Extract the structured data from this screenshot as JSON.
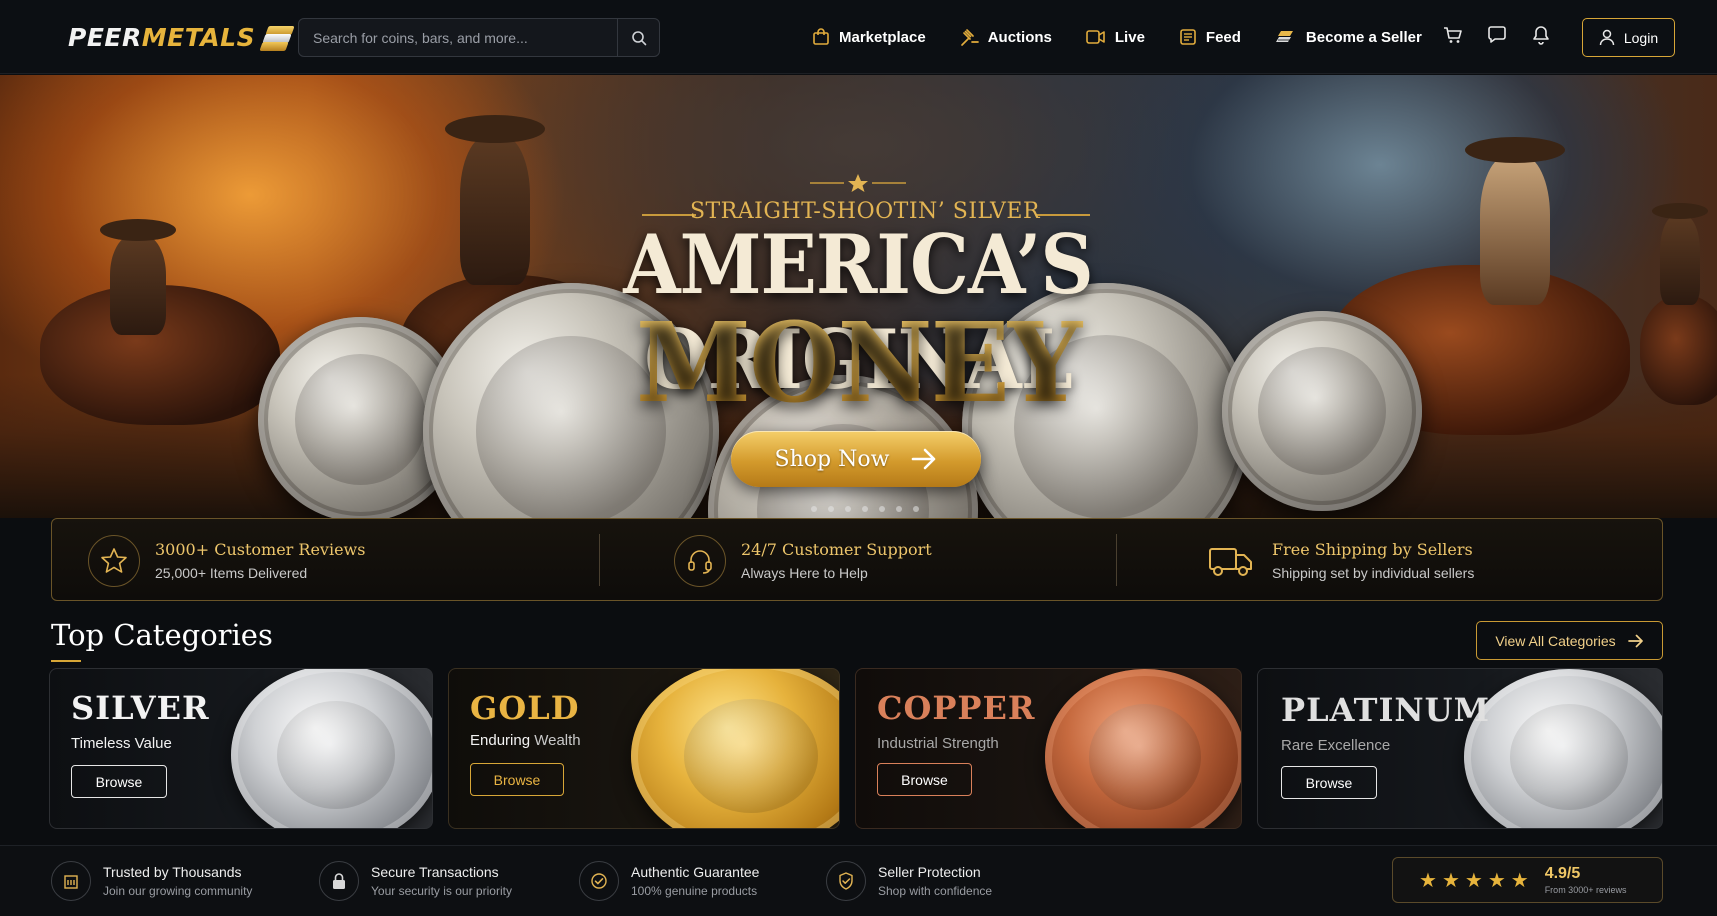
{
  "header": {
    "logo_part1": "PEER",
    "logo_part2": "METALS",
    "search_placeholder": "Search for coins, bars, and more...",
    "nav": [
      {
        "label": "Marketplace",
        "icon": "shopping-bag-icon"
      },
      {
        "label": "Auctions",
        "icon": "gavel-icon"
      },
      {
        "label": "Live",
        "icon": "video-camera-icon"
      },
      {
        "label": "Feed",
        "icon": "newsfeed-icon"
      },
      {
        "label": "Become a Seller",
        "icon": "gold-bars-icon"
      }
    ],
    "icons": [
      "cart-icon",
      "chat-icon",
      "bell-icon"
    ],
    "login_label": "Login"
  },
  "hero": {
    "kicker": "STRAIGHT-SHOOTIN’ SILVER",
    "title": "AMERICA’S ORIGINAL",
    "title_accent": "MONEY",
    "cta_label": "Shop Now",
    "colors": {
      "gold": "#e6ac3a",
      "cream": "#f4ead5"
    }
  },
  "features": [
    {
      "title": "3000+ Customer Reviews",
      "subtitle": "25,000+ Items Delivered",
      "icon": "star-icon"
    },
    {
      "title": "24/7 Customer Support",
      "subtitle": "Always Here to Help",
      "icon": "headset-icon"
    },
    {
      "title": "Free Shipping by Sellers",
      "subtitle": "Shipping set by individual sellers",
      "icon": "truck-icon"
    }
  ],
  "categories": {
    "title": "Top Categories",
    "view_all_label": "View All Categories",
    "items": [
      {
        "name": "SILVER",
        "subtitle": "Timeless Value",
        "button": "Browse",
        "color": "#f2f2f2"
      },
      {
        "name": "GOLD",
        "subtitle_a": "Enduring",
        "subtitle_b": "Wealth",
        "button": "Browse",
        "color": "#e9b443"
      },
      {
        "name": "COPPER",
        "subtitle": "Industrial Strength",
        "button": "Browse",
        "color": "#d9805a"
      },
      {
        "name": "PLATINUM",
        "subtitle": "Rare Excellence",
        "button": "Browse",
        "color": "#e0e0e0"
      }
    ]
  },
  "trust": [
    {
      "title": "Trusted by Thousands",
      "subtitle": "Join our growing community",
      "icon": "building-icon"
    },
    {
      "title": "Secure Transactions",
      "subtitle": "Your security is our priority",
      "icon": "lock-icon"
    },
    {
      "title": "Authentic Guarantee",
      "subtitle": "100% genuine products",
      "icon": "check-circle-icon"
    },
    {
      "title": "Seller Protection",
      "subtitle": "Shop with confidence",
      "icon": "shield-check-icon"
    }
  ],
  "rating": {
    "stars": 5,
    "value": "4.9/5",
    "subtitle": "From 3000+ reviews"
  }
}
